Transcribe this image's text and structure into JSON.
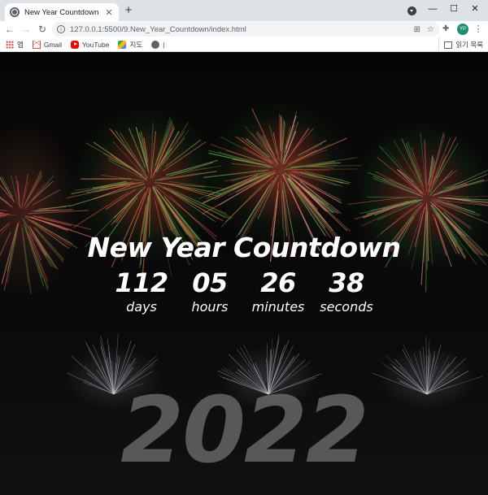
{
  "browser": {
    "tab_title": "New Year Countdown",
    "url": "127.0.0.1:5500/9.New_Year_Countdown/index.html",
    "profile_initials": "YP",
    "bookmarks": [
      {
        "label": "앱",
        "icon": "apps-icon"
      },
      {
        "label": "Gmail",
        "icon": "gmail-icon"
      },
      {
        "label": "YouTube",
        "icon": "youtube-icon"
      },
      {
        "label": "지도",
        "icon": "maps-icon"
      },
      {
        "label": "|",
        "icon": "globe-icon"
      }
    ],
    "reading_list_label": "읽기 목록"
  },
  "page": {
    "heading": "New Year Countdown",
    "countdown": [
      {
        "value": "112",
        "label": "days"
      },
      {
        "value": "05",
        "label": "hours"
      },
      {
        "value": "26",
        "label": "minutes"
      },
      {
        "value": "38",
        "label": "seconds"
      }
    ],
    "year": "2022"
  }
}
